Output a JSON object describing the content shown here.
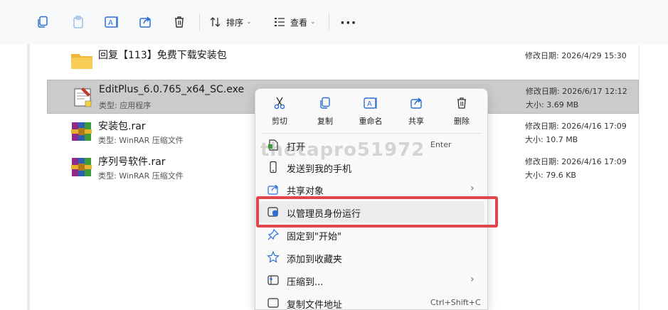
{
  "toolbar": {
    "sort_label": "排序",
    "view_label": "查看",
    "more_label": "···"
  },
  "files": [
    {
      "name": "回复【113】免费下载安装包",
      "type": "",
      "date": "修改日期: 2026/4/29 15:30",
      "size": ""
    },
    {
      "name": "EditPlus_6.0.765_x64_SC.exe",
      "type": "类型: 应用程序",
      "date": "修改日期: 2026/6/17 12:12",
      "size": "大小: 3.69 MB"
    },
    {
      "name": "安装包.rar",
      "type": "类型: WinRAR 压缩文件",
      "date": "修改日期: 2026/4/16 17:09",
      "size": "大小: 10.7 MB"
    },
    {
      "name": "序列号软件.rar",
      "type": "类型: WinRAR 压缩文件",
      "date": "修改日期: 2026/4/16 17:09",
      "size": "大小: 79.6 KB"
    }
  ],
  "watermark": "thetapro51972",
  "context_menu": {
    "quick_actions": [
      {
        "label": "剪切",
        "icon": "scissors-icon"
      },
      {
        "label": "复制",
        "icon": "copy-icon"
      },
      {
        "label": "重命名",
        "icon": "rename-icon"
      },
      {
        "label": "共享",
        "icon": "share-icon"
      },
      {
        "label": "删除",
        "icon": "trash-icon"
      }
    ],
    "items": [
      {
        "label": "打开",
        "shortcut": "Enter",
        "icon": "open-file-icon"
      },
      {
        "label": "发送到我的手机",
        "shortcut": "",
        "icon": "phone-icon"
      },
      {
        "label": "共享对象",
        "shortcut": "",
        "icon": "share-icon"
      },
      {
        "label": "以管理员身份运行",
        "shortcut": "",
        "icon": "shield-icon"
      },
      {
        "label": "固定到\"开始\"",
        "shortcut": "",
        "icon": "pin-icon"
      },
      {
        "label": "添加到收藏夹",
        "shortcut": "",
        "icon": "star-icon"
      },
      {
        "label": "压缩到...",
        "shortcut": "",
        "icon": "zip-icon"
      },
      {
        "label": "复制文件地址",
        "shortcut": "Ctrl+Shift+C",
        "icon": "path-icon"
      }
    ]
  },
  "colors": {
    "highlight_border": "#e0474c",
    "accent": "#2b6fd6",
    "selected_row": "#cbcbcb"
  }
}
